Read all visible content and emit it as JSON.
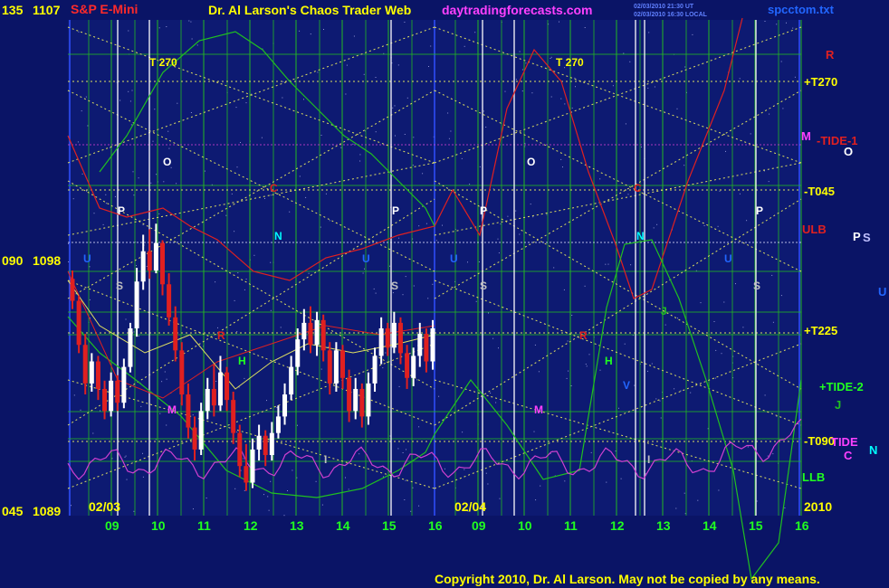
{
  "header": {
    "instrument": "S&P E-Mini",
    "chart_title": "Dr. Al Larson's Chaos Trader Web",
    "site": "daytradingforecasts.com",
    "stamp_line1": "02/03/2010 21:30 UT",
    "stamp_line2": "02/03/2010 16:30 LOCAL",
    "file": "spcctom.txt"
  },
  "footer": {
    "copyright": "Copyright 2010, Dr. Al Larson. May not be copied by any means."
  },
  "colors": {
    "background": "#0a1466",
    "grid_vertical": "#22b822",
    "grid_horizontal": "#22b822",
    "yellow_dotted": "#e0e060",
    "price_up": "#ffffff",
    "price_down": "#e02020",
    "red_curve": "#e02020",
    "green_curve": "#20c020",
    "magenta_curve": "#d040d0",
    "blue_curve": "#2040e0",
    "white_line": "#ffffff",
    "header_red": "#ff2a2a",
    "header_yellow": "#ffff00",
    "header_magenta": "#ff40ff",
    "header_blue": "#2266ff",
    "yellow_label": "#ffff00"
  },
  "chart_data": {
    "type": "line",
    "title": "Dr. Al Larson's Chaos Trader Web",
    "instrument": "S&P E-Mini",
    "ylim": [
      1089,
      1107
    ],
    "y_ticks": [
      {
        "price": "1107",
        "degree": "135",
        "value": 1107
      },
      {
        "price": "1098",
        "degree": "090",
        "value": 1098
      },
      {
        "price": "1089",
        "degree": "045",
        "value": 1089
      }
    ],
    "x_hour_labels": [
      "09",
      "10",
      "11",
      "12",
      "13",
      "14",
      "15",
      "16",
      "09",
      "10",
      "11",
      "12",
      "13",
      "14",
      "15",
      "16"
    ],
    "date_labels": [
      "02/03",
      "02/04"
    ],
    "year_label": "2010",
    "right_labels": [
      {
        "text": "R",
        "color": "#e02020"
      },
      {
        "text": "+T270",
        "color": "#ffff00"
      },
      {
        "text": "M",
        "color": "#ff40ff"
      },
      {
        "text": "-TIDE-1",
        "color": "#e02020"
      },
      {
        "text": "O",
        "color": "#ffffff"
      },
      {
        "text": "-T045",
        "color": "#ffff00"
      },
      {
        "text": "ULB",
        "color": "#e02020"
      },
      {
        "text": "P",
        "color": "#ffffff"
      },
      {
        "text": "S",
        "color": "#c0c0ff"
      },
      {
        "text": "U",
        "color": "#2266ff"
      },
      {
        "text": "+T225",
        "color": "#ffff00"
      },
      {
        "text": "+TIDE-2",
        "color": "#20ff20"
      },
      {
        "text": "J",
        "color": "#20c020"
      },
      {
        "text": "-T090",
        "color": "#ffff00"
      },
      {
        "text": "TIDE",
        "color": "#ff40ff"
      },
      {
        "text": "C",
        "color": "#ff40ff"
      },
      {
        "text": "N",
        "color": "#00ffff"
      },
      {
        "text": "LLB",
        "color": "#20ff20"
      }
    ],
    "in_chart_labels": [
      {
        "text": "T  270",
        "color": "#ffff00"
      },
      {
        "text": "T  270",
        "color": "#ffff00"
      },
      {
        "text": "O",
        "color": "#ffffff"
      },
      {
        "text": "O",
        "color": "#ffffff"
      },
      {
        "text": "P",
        "color": "#ffffff"
      },
      {
        "text": "P",
        "color": "#ffffff"
      },
      {
        "text": "P",
        "color": "#ffffff"
      },
      {
        "text": "P",
        "color": "#ffffff"
      },
      {
        "text": "C",
        "color": "#e02020"
      },
      {
        "text": "C",
        "color": "#e02020"
      },
      {
        "text": "N",
        "color": "#00ffff"
      },
      {
        "text": "N",
        "color": "#00ffff"
      },
      {
        "text": "U",
        "color": "#2266ff"
      },
      {
        "text": "U",
        "color": "#2266ff"
      },
      {
        "text": "U",
        "color": "#2266ff"
      },
      {
        "text": "U",
        "color": "#2266ff"
      },
      {
        "text": "S",
        "color": "#c0c0c0"
      },
      {
        "text": "S",
        "color": "#c0c0c0"
      },
      {
        "text": "S",
        "color": "#c0c0c0"
      },
      {
        "text": "S",
        "color": "#c0c0c0"
      },
      {
        "text": "R",
        "color": "#e02020"
      },
      {
        "text": "R",
        "color": "#e02020"
      },
      {
        "text": "H",
        "color": "#20ff20"
      },
      {
        "text": "H",
        "color": "#20ff20"
      },
      {
        "text": "J",
        "color": "#20c020"
      },
      {
        "text": "V",
        "color": "#2266ff"
      },
      {
        "text": "M",
        "color": "#ff40ff"
      },
      {
        "text": "M",
        "color": "#ff40ff"
      },
      {
        "text": "I",
        "color": "#c0c0c0"
      },
      {
        "text": "I",
        "color": "#c0c0c0"
      }
    ],
    "price_bars": [
      {
        "up": false,
        "o": 1097.6,
        "c": 1096.8,
        "h": 1097.9,
        "l": 1096.5
      },
      {
        "up": false,
        "o": 1096.8,
        "c": 1095.2,
        "h": 1097.0,
        "l": 1094.9
      },
      {
        "up": false,
        "o": 1095.2,
        "c": 1093.8,
        "h": 1095.6,
        "l": 1093.4
      },
      {
        "up": true,
        "o": 1093.8,
        "c": 1094.6,
        "h": 1094.9,
        "l": 1093.5
      },
      {
        "up": false,
        "o": 1094.6,
        "c": 1093.6,
        "h": 1094.8,
        "l": 1093.2
      },
      {
        "up": false,
        "o": 1093.6,
        "c": 1092.8,
        "h": 1093.9,
        "l": 1092.5
      },
      {
        "up": true,
        "o": 1092.8,
        "c": 1093.9,
        "h": 1094.2,
        "l": 1092.6
      },
      {
        "up": false,
        "o": 1093.9,
        "c": 1093.1,
        "h": 1094.1,
        "l": 1092.8
      },
      {
        "up": true,
        "o": 1093.1,
        "c": 1094.4,
        "h": 1094.7,
        "l": 1092.9
      },
      {
        "up": true,
        "o": 1094.4,
        "c": 1095.8,
        "h": 1096.0,
        "l": 1094.2
      },
      {
        "up": true,
        "o": 1095.8,
        "c": 1097.5,
        "h": 1098.0,
        "l": 1095.5
      },
      {
        "up": true,
        "o": 1097.5,
        "c": 1098.6,
        "h": 1099.2,
        "l": 1097.2
      },
      {
        "up": false,
        "o": 1098.6,
        "c": 1097.9,
        "h": 1099.4,
        "l": 1097.6
      },
      {
        "up": true,
        "o": 1097.9,
        "c": 1098.9,
        "h": 1099.6,
        "l": 1097.8
      },
      {
        "up": false,
        "o": 1098.9,
        "c": 1097.4,
        "h": 1099.0,
        "l": 1097.0
      },
      {
        "up": false,
        "o": 1097.4,
        "c": 1096.2,
        "h": 1097.8,
        "l": 1095.9
      },
      {
        "up": false,
        "o": 1096.2,
        "c": 1095.0,
        "h": 1096.6,
        "l": 1094.6
      },
      {
        "up": false,
        "o": 1095.0,
        "c": 1093.4,
        "h": 1095.3,
        "l": 1093.0
      },
      {
        "up": false,
        "o": 1093.4,
        "c": 1092.2,
        "h": 1093.8,
        "l": 1091.8
      },
      {
        "up": false,
        "o": 1092.2,
        "c": 1091.4,
        "h": 1092.6,
        "l": 1091.0
      },
      {
        "up": true,
        "o": 1091.4,
        "c": 1092.8,
        "h": 1093.1,
        "l": 1091.2
      },
      {
        "up": true,
        "o": 1092.8,
        "c": 1093.6,
        "h": 1094.0,
        "l": 1092.5
      },
      {
        "up": false,
        "o": 1093.6,
        "c": 1093.0,
        "h": 1094.5,
        "l": 1092.6
      },
      {
        "up": true,
        "o": 1093.0,
        "c": 1094.2,
        "h": 1094.8,
        "l": 1092.8
      },
      {
        "up": false,
        "o": 1094.2,
        "c": 1093.2,
        "h": 1094.4,
        "l": 1092.8
      },
      {
        "up": false,
        "o": 1093.2,
        "c": 1092.0,
        "h": 1093.5,
        "l": 1091.6
      },
      {
        "up": false,
        "o": 1092.0,
        "c": 1090.8,
        "h": 1092.3,
        "l": 1090.4
      },
      {
        "up": false,
        "o": 1090.8,
        "c": 1090.2,
        "h": 1091.6,
        "l": 1089.9
      },
      {
        "up": true,
        "o": 1090.2,
        "c": 1091.4,
        "h": 1091.8,
        "l": 1090.0
      },
      {
        "up": true,
        "o": 1091.4,
        "c": 1091.9,
        "h": 1092.3,
        "l": 1091.0
      },
      {
        "up": false,
        "o": 1091.9,
        "c": 1091.2,
        "h": 1092.1,
        "l": 1090.8
      },
      {
        "up": true,
        "o": 1091.2,
        "c": 1092.0,
        "h": 1092.4,
        "l": 1091.0
      },
      {
        "up": true,
        "o": 1092.0,
        "c": 1092.6,
        "h": 1093.0,
        "l": 1091.8
      },
      {
        "up": true,
        "o": 1092.6,
        "c": 1093.4,
        "h": 1093.8,
        "l": 1092.3
      },
      {
        "up": true,
        "o": 1093.4,
        "c": 1094.4,
        "h": 1094.8,
        "l": 1093.2
      },
      {
        "up": true,
        "o": 1094.4,
        "c": 1095.4,
        "h": 1095.8,
        "l": 1094.1
      },
      {
        "up": true,
        "o": 1095.4,
        "c": 1096.0,
        "h": 1096.5,
        "l": 1095.0
      },
      {
        "up": false,
        "o": 1096.0,
        "c": 1095.2,
        "h": 1096.6,
        "l": 1094.9
      },
      {
        "up": true,
        "o": 1095.2,
        "c": 1096.1,
        "h": 1096.4,
        "l": 1094.8
      },
      {
        "up": false,
        "o": 1096.1,
        "c": 1095.0,
        "h": 1096.3,
        "l": 1094.6
      },
      {
        "up": false,
        "o": 1095.0,
        "c": 1093.8,
        "h": 1095.3,
        "l": 1093.4
      },
      {
        "up": true,
        "o": 1093.8,
        "c": 1095.0,
        "h": 1095.3,
        "l": 1093.5
      },
      {
        "up": false,
        "o": 1095.0,
        "c": 1094.0,
        "h": 1095.2,
        "l": 1093.6
      },
      {
        "up": false,
        "o": 1094.0,
        "c": 1092.8,
        "h": 1094.3,
        "l": 1092.4
      },
      {
        "up": true,
        "o": 1092.8,
        "c": 1093.6,
        "h": 1094.0,
        "l": 1092.5
      },
      {
        "up": false,
        "o": 1093.6,
        "c": 1092.6,
        "h": 1093.8,
        "l": 1092.2
      },
      {
        "up": true,
        "o": 1092.6,
        "c": 1093.8,
        "h": 1094.2,
        "l": 1092.3
      },
      {
        "up": true,
        "o": 1093.8,
        "c": 1094.8,
        "h": 1095.1,
        "l": 1093.5
      },
      {
        "up": true,
        "o": 1094.8,
        "c": 1095.8,
        "h": 1096.2,
        "l": 1094.5
      },
      {
        "up": false,
        "o": 1095.8,
        "c": 1095.1,
        "h": 1096.0,
        "l": 1094.8
      },
      {
        "up": true,
        "o": 1095.1,
        "c": 1096.0,
        "h": 1096.4,
        "l": 1094.9
      },
      {
        "up": false,
        "o": 1096.0,
        "c": 1094.9,
        "h": 1096.2,
        "l": 1094.5
      },
      {
        "up": false,
        "o": 1094.9,
        "c": 1094.0,
        "h": 1095.2,
        "l": 1093.6
      },
      {
        "up": true,
        "o": 1094.0,
        "c": 1094.8,
        "h": 1095.1,
        "l": 1093.7
      },
      {
        "up": true,
        "o": 1094.8,
        "c": 1095.6,
        "h": 1096.0,
        "l": 1094.4
      },
      {
        "up": false,
        "o": 1095.6,
        "c": 1094.6,
        "h": 1095.8,
        "l": 1094.2
      },
      {
        "up": true,
        "o": 1094.6,
        "c": 1095.8,
        "h": 1096.1,
        "l": 1094.3
      }
    ]
  }
}
